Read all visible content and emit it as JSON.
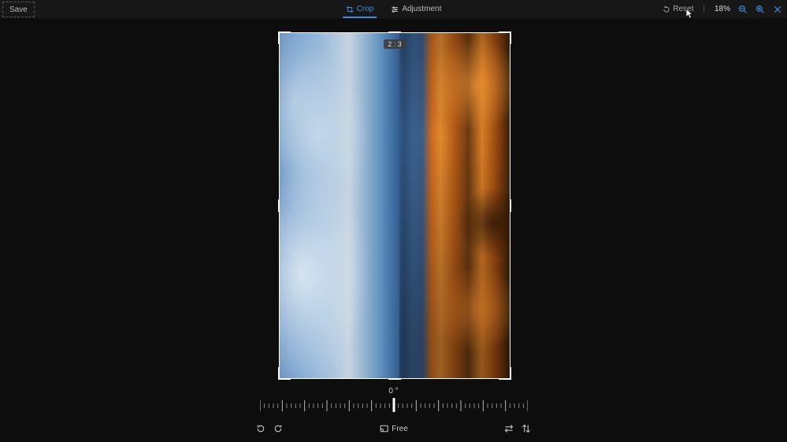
{
  "toolbar": {
    "save_label": "Save",
    "crop_label": "Crop",
    "adjustment_label": "Adjustment",
    "reset_label": "Reset",
    "zoom_pct": "18%"
  },
  "crop": {
    "ratio_badge": "2 : 3"
  },
  "controls": {
    "angle_label": "0 °",
    "free_label": "Free"
  }
}
